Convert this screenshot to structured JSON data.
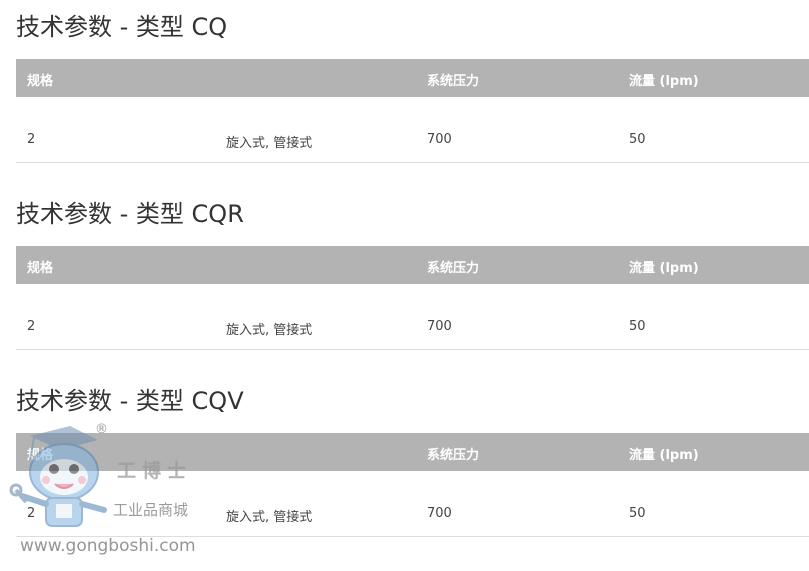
{
  "sections": [
    {
      "title": "技术参数 - 类型 CQ",
      "headers": [
        "规格",
        "",
        "系统压力",
        "流量 (lpm)"
      ],
      "row": [
        "2",
        "旋入式, 管接式",
        "700",
        "50"
      ]
    },
    {
      "title": "技术参数 - 类型 CQR",
      "headers": [
        "规格",
        "",
        "系统压力",
        "流量 (lpm)"
      ],
      "row": [
        "2",
        "旋入式, 管接式",
        "700",
        "50"
      ]
    },
    {
      "title": "技术参数 - 类型 CQV",
      "headers": [
        "规格",
        "",
        "系统压力",
        "流量 (lpm)"
      ],
      "row": [
        "2",
        "旋入式, 管接式",
        "700",
        "50"
      ]
    }
  ],
  "watermark": {
    "brand": "工博士",
    "subtitle": "工业品商城",
    "url": "www.gongboshi.com",
    "registered_mark": "®",
    "mascot_icon": "robot-mascot-icon"
  },
  "colors": {
    "header_bg": "#b3b3b3",
    "header_text": "#ffffff",
    "row_border": "#dddddd",
    "title_text": "#333333"
  }
}
